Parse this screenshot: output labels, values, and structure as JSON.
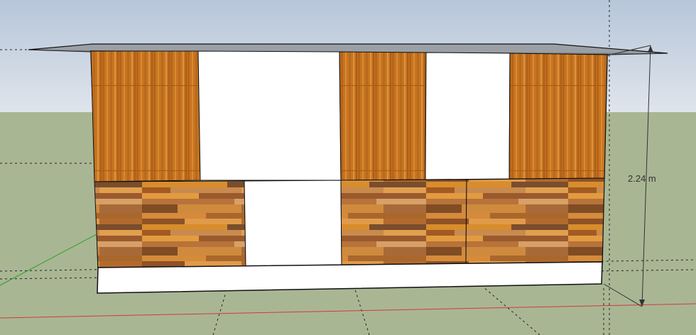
{
  "model": {
    "dimension_label": "2.24 m",
    "colors": {
      "sky_top": "#b7c6da",
      "sky_bottom": "#dfe5ec",
      "ground": "#a9b694",
      "edge": "#111111",
      "opening": "#ffffff",
      "roof": "#9aa0a6",
      "axis_red": "#d23a3a",
      "axis_green": "#2aa12a",
      "guide": "#222222"
    },
    "materials": {
      "upper_panel": "vertical-wood-texture",
      "lower_panel": "mixed-wood-plank-texture",
      "base": "white-plinth"
    }
  }
}
